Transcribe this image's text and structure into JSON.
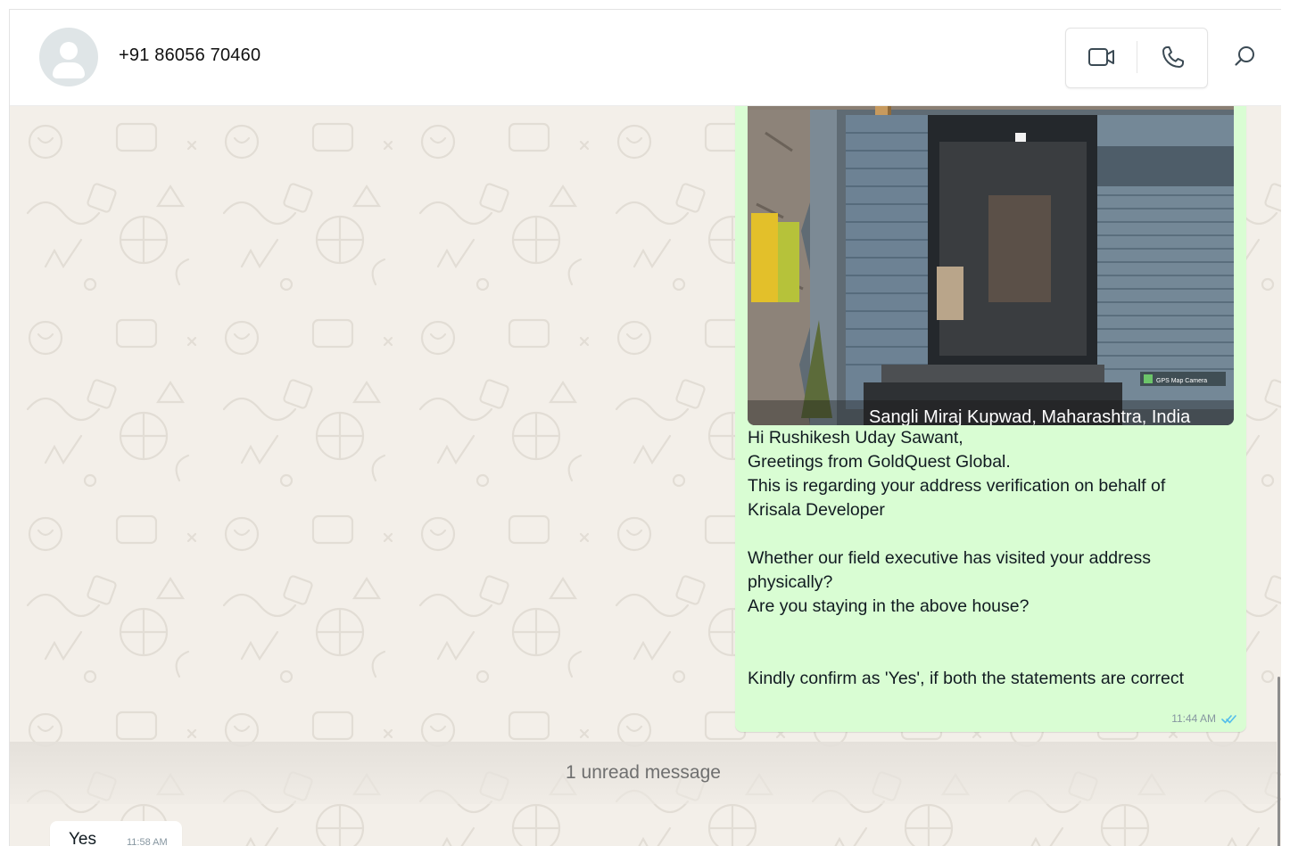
{
  "header": {
    "contact_name": "+91 86056 70460",
    "icons": {
      "avatar": "default-avatar-icon",
      "video": "video-camera-icon",
      "phone": "phone-icon",
      "search": "search-icon"
    }
  },
  "messages": {
    "outgoing": {
      "photo_caption": "Sangli Miraj Kupwad, Maharashtra, India",
      "photo_watermark": "GPS Map Camera",
      "lines": [
        "Hi Rushikesh Uday Sawant,",
        "Greetings from GoldQuest Global.",
        "This is regarding your address verification on behalf of",
        "Krisala Developer",
        "",
        "Whether our field executive has visited your address",
        "physically?",
        "Are you staying in the above house?",
        "",
        "",
        "Kindly confirm as 'Yes', if both the statements are correct"
      ],
      "time": "11:44 AM",
      "status_icon": "double-check-read-icon"
    },
    "unread_divider": "1 unread message",
    "incoming": {
      "text": "Yes",
      "time": "11:58 AM"
    }
  },
  "colors": {
    "outgoing_bubble": "#d9fdd3",
    "incoming_bubble": "#ffffff",
    "chat_background": "#f3efe9",
    "read_tick": "#53bdeb"
  }
}
